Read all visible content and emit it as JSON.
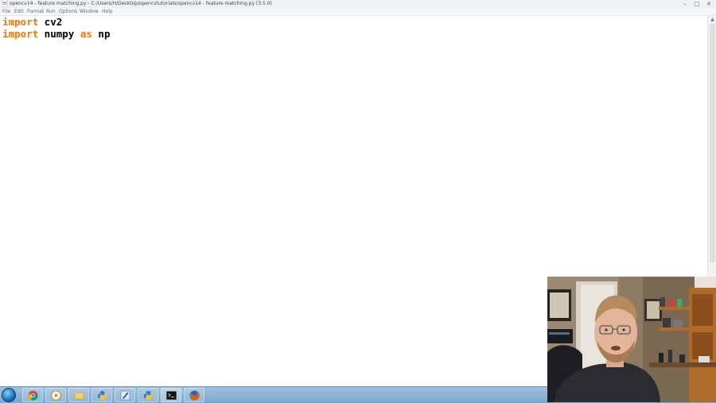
{
  "window": {
    "title": "opencv14 - feature matching.py - C:/Users/H/Desktop/opencvtutorials/opencv14 - feature matching.py (3.5.0)",
    "controls": {
      "minimize": "–",
      "maximize": "□",
      "close": "✕"
    }
  },
  "menu": {
    "items": [
      "File",
      "Edit",
      "Format",
      "Run",
      "Options",
      "Window",
      "Help"
    ]
  },
  "editor": {
    "lines": [
      {
        "keyword": "import",
        "rest": " cv2"
      },
      {
        "keyword": "import",
        "middle": " numpy ",
        "keyword2": "as",
        "rest": " np"
      }
    ]
  },
  "scrollbar": {
    "up_arrow": "▲"
  },
  "taskbar": {
    "apps": [
      "chrome-icon",
      "media-player-icon",
      "file-explorer-icon",
      "python-icon",
      "pen-tool-icon",
      "python-shell-icon",
      "terminal-icon",
      "firefox-icon"
    ]
  },
  "colors": {
    "keyword": "#ff7700",
    "taskbar": "#8fb4d6",
    "titlebar": "#eef1f5"
  }
}
